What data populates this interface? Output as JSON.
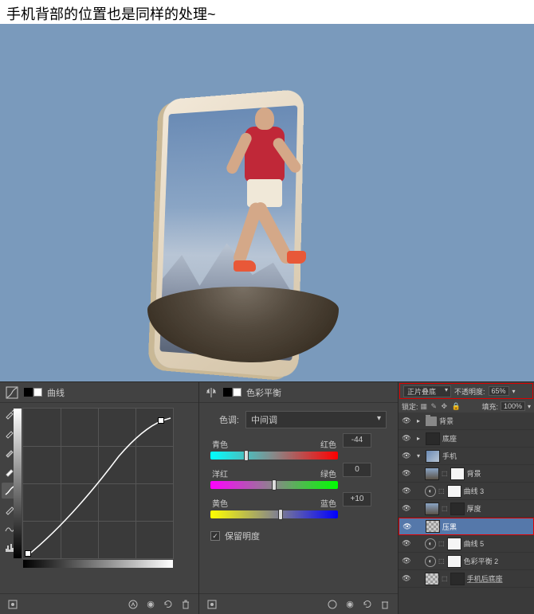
{
  "caption": "手机背部的位置也是同样的处理~",
  "curves_panel": {
    "title": "曲线"
  },
  "color_panel": {
    "title": "色彩平衡",
    "tone_label": "色调:",
    "tone_value": "中间调",
    "sliders": [
      {
        "left": "青色",
        "right": "红色",
        "value": "-44",
        "pos": 28
      },
      {
        "left": "洋红",
        "right": "绿色",
        "value": "0",
        "pos": 50
      },
      {
        "left": "黄色",
        "right": "蓝色",
        "value": "+10",
        "pos": 55
      }
    ],
    "preserve_label": "保留明度",
    "preserve_checked": true
  },
  "layers_panel": {
    "blend_mode": "正片叠底",
    "opacity_label": "不透明度:",
    "opacity_value": "65%",
    "lock_label": "锁定:",
    "fill_label": "填充:",
    "fill_value": "100%",
    "layers": [
      {
        "eye": true,
        "indent": 0,
        "type": "folder",
        "arrow": "▸",
        "name": "背景"
      },
      {
        "eye": true,
        "indent": 0,
        "type": "folder",
        "arrow": "▸",
        "thumb": "dark",
        "name": "底座"
      },
      {
        "eye": true,
        "indent": 0,
        "type": "folder",
        "arrow": "▾",
        "thumb": "img1",
        "name": "手机"
      },
      {
        "eye": true,
        "indent": 1,
        "type": "layer",
        "thumb": "img2",
        "mask": "white",
        "name": "背景"
      },
      {
        "eye": true,
        "indent": 1,
        "type": "adj",
        "adj": "curves",
        "mask": "white",
        "name": "曲线 3"
      },
      {
        "eye": true,
        "indent": 1,
        "type": "layer",
        "thumb": "img2",
        "mask": "dark",
        "name": "厚度"
      },
      {
        "eye": true,
        "indent": 1,
        "type": "layer",
        "thumb": "checker",
        "name": "压黑",
        "selected": true
      },
      {
        "eye": true,
        "indent": 1,
        "type": "adj",
        "adj": "curves",
        "mask": "white",
        "name": "曲线 5"
      },
      {
        "eye": true,
        "indent": 1,
        "type": "adj",
        "adj": "balance",
        "mask": "white",
        "name": "色彩平衡 2"
      },
      {
        "eye": true,
        "indent": 1,
        "type": "layer",
        "thumb": "checker",
        "mask": "dark",
        "name": "手机后底座",
        "underline": true
      }
    ]
  }
}
